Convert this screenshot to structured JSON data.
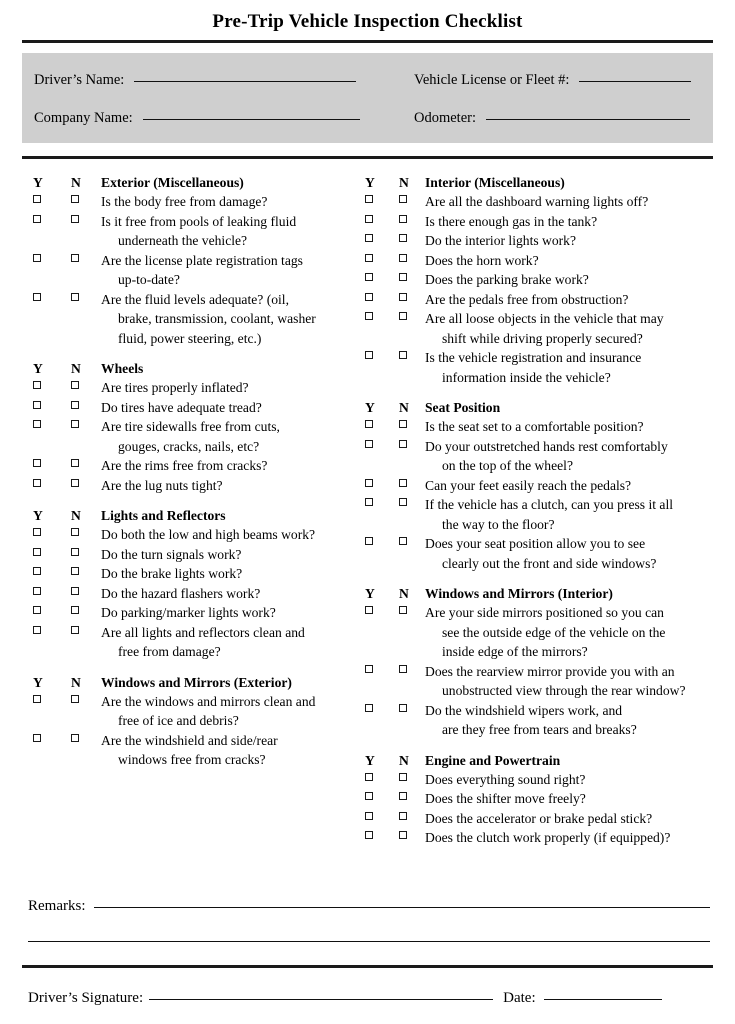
{
  "document": {
    "title": "Pre-Trip Vehicle Inspection Checklist"
  },
  "header_fields": {
    "drivers_name_label": "Driver’s Name:",
    "drivers_name_value": "",
    "company_name_label": "Company Name:",
    "company_name_value": "",
    "vehicle_license_label": "Vehicle License or Fleet #:",
    "vehicle_license_value": "",
    "odometer_label": "Odometer:",
    "odometer_value": ""
  },
  "column_headers": {
    "yes": "Y",
    "no": "N"
  },
  "left_column": [
    {
      "title": "Exterior (Miscellaneous)",
      "items": [
        {
          "lines": [
            "Is the body free from damage?"
          ]
        },
        {
          "lines": [
            "Is it free from pools of leaking fluid",
            "underneath the vehicle?"
          ]
        },
        {
          "lines": [
            "Are the license plate registration tags",
            "up-to-date?"
          ]
        },
        {
          "lines": [
            "Are the fluid levels adequate? (oil,",
            "brake, transmission, coolant, washer",
            "fluid, power steering, etc.)"
          ]
        }
      ]
    },
    {
      "title": "Wheels",
      "items": [
        {
          "lines": [
            "Are tires properly inflated?"
          ]
        },
        {
          "lines": [
            "Do tires have adequate tread?"
          ]
        },
        {
          "lines": [
            "Are tire sidewalls free from cuts,",
            "gouges, cracks, nails, etc?"
          ]
        },
        {
          "lines": [
            "Are the rims free from cracks?"
          ]
        },
        {
          "lines": [
            "Are the lug nuts tight?"
          ]
        }
      ]
    },
    {
      "title": "Lights and Reflectors",
      "items": [
        {
          "lines": [
            "Do both the low and high beams work?"
          ]
        },
        {
          "lines": [
            "Do the turn signals work?"
          ]
        },
        {
          "lines": [
            "Do the brake lights work?"
          ]
        },
        {
          "lines": [
            "Do the hazard flashers work?"
          ]
        },
        {
          "lines": [
            "Do parking/marker lights work?"
          ]
        },
        {
          "lines": [
            "Are all lights and reflectors clean and",
            "free from damage?"
          ]
        }
      ]
    },
    {
      "title": "Windows and Mirrors (Exterior)",
      "items": [
        {
          "lines": [
            "Are the windows and mirrors clean and",
            "free of ice and debris?"
          ]
        },
        {
          "lines": [
            "Are the windshield and side/rear",
            "windows free from cracks?"
          ]
        }
      ]
    }
  ],
  "right_column": [
    {
      "title": "Interior (Miscellaneous)",
      "items": [
        {
          "lines": [
            "Are all the dashboard warning lights off?"
          ]
        },
        {
          "lines": [
            "Is there enough gas in the tank?"
          ]
        },
        {
          "lines": [
            "Do the interior lights work?"
          ]
        },
        {
          "lines": [
            "Does the horn work?"
          ]
        },
        {
          "lines": [
            "Does the parking brake work?"
          ]
        },
        {
          "lines": [
            "Are the pedals free from obstruction?"
          ]
        },
        {
          "lines": [
            "Are all loose objects in the vehicle that may",
            "shift while driving properly secured?"
          ]
        },
        {
          "lines": [
            "Is the vehicle registration and insurance",
            "information inside the vehicle?"
          ]
        }
      ]
    },
    {
      "title": "Seat Position",
      "items": [
        {
          "lines": [
            "Is the seat set to a comfortable position?"
          ]
        },
        {
          "lines": [
            "Do your outstretched hands rest comfortably",
            "on the top of the wheel?"
          ]
        },
        {
          "lines": [
            "Can your feet easily reach the pedals?"
          ]
        },
        {
          "lines": [
            "If the vehicle has a clutch, can you press it all",
            "the way to the floor?"
          ]
        },
        {
          "lines": [
            "Does your seat position allow you to see",
            "clearly out the front and side windows?"
          ]
        }
      ]
    },
    {
      "title": "Windows and Mirrors (Interior)",
      "items": [
        {
          "lines": [
            "Are your side mirrors positioned so you can",
            "see the outside edge of the vehicle on the",
            "inside edge of the mirrors?"
          ]
        },
        {
          "lines": [
            "Does the rearview mirror provide you with an",
            "unobstructed view through the rear window?"
          ]
        },
        {
          "lines": [
            "Do the windshield wipers work, and",
            "are they free from tears and breaks?"
          ]
        }
      ]
    },
    {
      "title": "Engine and Powertrain",
      "items": [
        {
          "lines": [
            "Does everything sound right?"
          ]
        },
        {
          "lines": [
            "Does the shifter move freely?"
          ]
        },
        {
          "lines": [
            "Does the accelerator or brake pedal stick?"
          ]
        },
        {
          "lines": [
            "Does the clutch work properly (if equipped)?"
          ]
        }
      ]
    }
  ],
  "footer": {
    "remarks_label": "Remarks:",
    "remarks_value": "",
    "signature_label": "Driver’s Signature:",
    "signature_value": "",
    "date_label": "Date:",
    "date_value": ""
  },
  "colors": {
    "panel_background": "#cfcfcf",
    "rule": "#1a1a1a",
    "text": "#000000",
    "page_background": "#ffffff"
  }
}
